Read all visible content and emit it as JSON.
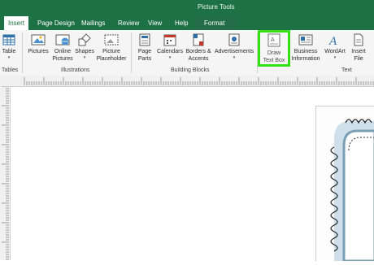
{
  "window": {
    "context_title": "Picture Tools"
  },
  "tabs": [
    {
      "label": "Insert",
      "active": true
    },
    {
      "label": "Page Design"
    },
    {
      "label": "Mailings"
    },
    {
      "label": "Review"
    },
    {
      "label": "View"
    },
    {
      "label": "Help"
    },
    {
      "label": "Format"
    }
  ],
  "ribbon": {
    "groups": {
      "tables": "Tables",
      "illustrations": "Illustrations",
      "building_blocks": "Building Blocks",
      "text": "Text"
    },
    "buttons": {
      "table": "Table",
      "pictures": "Pictures",
      "online_pictures": [
        "Online",
        "Pictures"
      ],
      "shapes": "Shapes",
      "picture_placeholder": [
        "Picture",
        "Placeholder"
      ],
      "page_parts": [
        "Page",
        "Parts"
      ],
      "calendars": "Calendars",
      "borders_accents": [
        "Borders &",
        "Accents"
      ],
      "advertisements": "Advertisements",
      "draw_text_box": [
        "Draw",
        "Text Box"
      ],
      "business_information": [
        "Business",
        "Information"
      ],
      "wordart": "WordArt",
      "insert_file": [
        "Insert",
        "File"
      ]
    }
  },
  "colors": {
    "accent": "#1e7145",
    "highlight": "#35e014"
  }
}
